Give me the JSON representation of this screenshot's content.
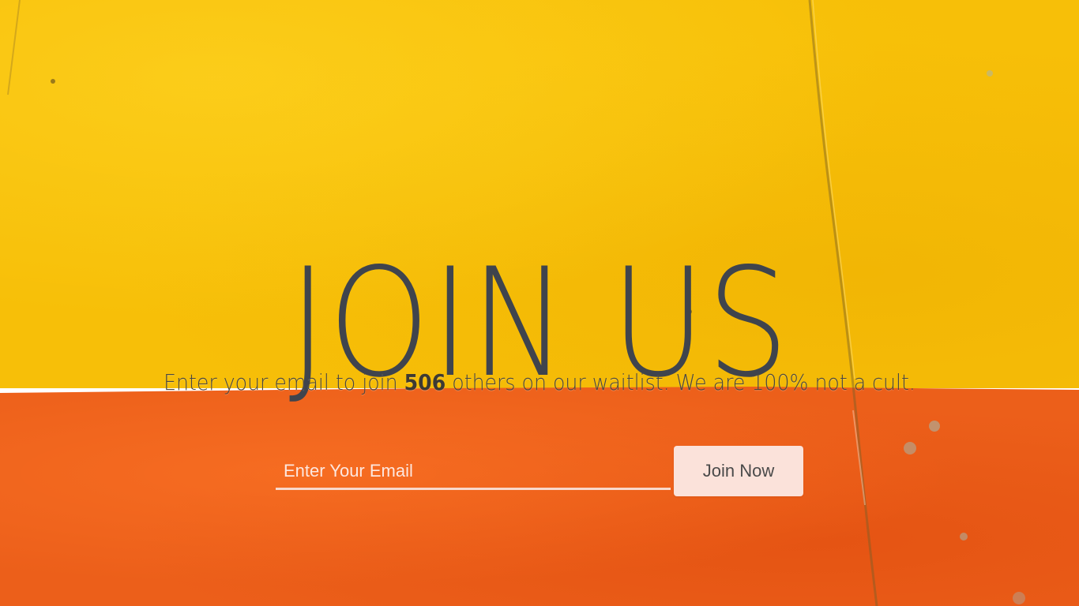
{
  "hero": {
    "title": "JOIN US",
    "subtitle_prefix": "Enter your email to join",
    "subtitle_count": "506",
    "subtitle_suffix": "others on our waitlist. We are 100% not a cult."
  },
  "form": {
    "email_placeholder": "Enter Your Email",
    "email_value": "",
    "submit_label": "Join Now"
  },
  "colors": {
    "top_background": "#f7bf08",
    "bottom_background": "#ec5f1a",
    "title_text": "#3f444d",
    "button_background": "#fbe2da",
    "input_underline": "#f8d8cc"
  }
}
